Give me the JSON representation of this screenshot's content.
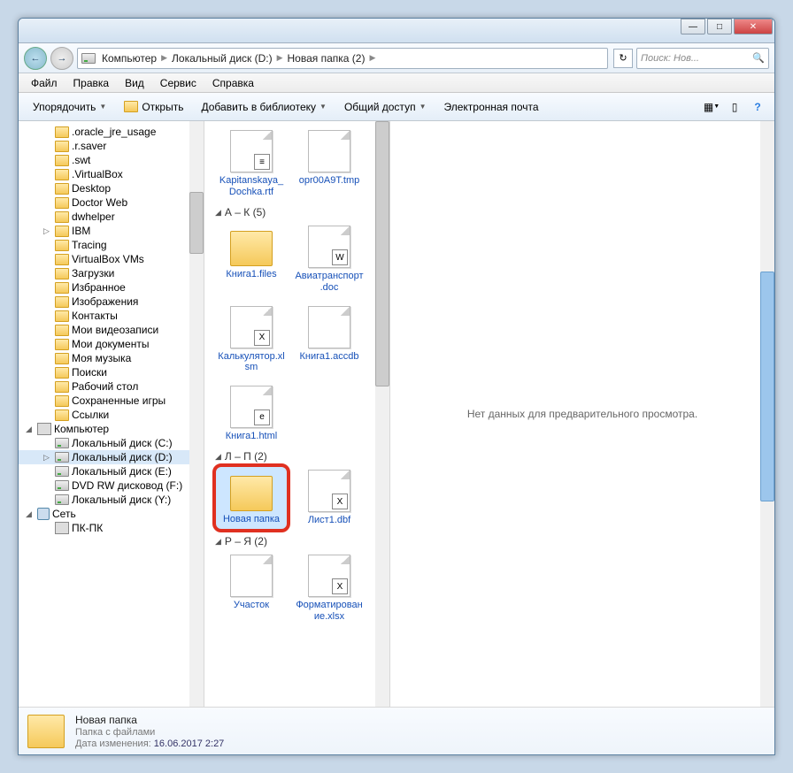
{
  "titlebar": {
    "min": "—",
    "max": "□",
    "close": "✕"
  },
  "nav": {
    "back": "←",
    "fwd": "→"
  },
  "breadcrumb": {
    "root": "Компьютер",
    "drive": "Локальный диск (D:)",
    "folder": "Новая папка (2)"
  },
  "refresh": "↻",
  "search": {
    "placeholder": "Поиск: Нов..."
  },
  "menu": {
    "file": "Файл",
    "edit": "Правка",
    "view": "Вид",
    "tools": "Сервис",
    "help": "Справка"
  },
  "toolbar": {
    "organize": "Упорядочить",
    "open": "Открыть",
    "library": "Добавить в библиотеку",
    "share": "Общий доступ",
    "email": "Электронная почта",
    "help": "?"
  },
  "tree": {
    "items": [
      {
        "l": 1,
        "icon": "folder",
        "label": ".oracle_jre_usage"
      },
      {
        "l": 1,
        "icon": "folder",
        "label": ".r.saver"
      },
      {
        "l": 1,
        "icon": "folder",
        "label": ".swt"
      },
      {
        "l": 1,
        "icon": "folder",
        "label": ".VirtualBox"
      },
      {
        "l": 1,
        "icon": "folder",
        "label": "Desktop"
      },
      {
        "l": 1,
        "icon": "folder",
        "label": "Doctor Web"
      },
      {
        "l": 1,
        "icon": "folder",
        "label": "dwhelper"
      },
      {
        "l": 1,
        "icon": "folder",
        "label": "IBM",
        "exp": "▷"
      },
      {
        "l": 1,
        "icon": "folder",
        "label": "Tracing"
      },
      {
        "l": 1,
        "icon": "folder",
        "label": "VirtualBox VMs"
      },
      {
        "l": 1,
        "icon": "folder",
        "label": "Загрузки"
      },
      {
        "l": 1,
        "icon": "folder",
        "label": "Избранное"
      },
      {
        "l": 1,
        "icon": "folder",
        "label": "Изображения"
      },
      {
        "l": 1,
        "icon": "folder",
        "label": "Контакты"
      },
      {
        "l": 1,
        "icon": "folder",
        "label": "Мои видеозаписи"
      },
      {
        "l": 1,
        "icon": "folder",
        "label": "Мои документы"
      },
      {
        "l": 1,
        "icon": "folder",
        "label": "Моя музыка"
      },
      {
        "l": 1,
        "icon": "folder",
        "label": "Поиски"
      },
      {
        "l": 1,
        "icon": "folder",
        "label": "Рабочий стол"
      },
      {
        "l": 1,
        "icon": "folder",
        "label": "Сохраненные игры"
      },
      {
        "l": 1,
        "icon": "folder",
        "label": "Ссылки"
      },
      {
        "l": 0,
        "icon": "comp",
        "label": "Компьютер",
        "exp": "◢"
      },
      {
        "l": 1,
        "icon": "drive",
        "label": "Локальный диск (C:)"
      },
      {
        "l": 1,
        "icon": "drive",
        "label": "Локальный диск (D:)",
        "sel": true,
        "exp": "▷"
      },
      {
        "l": 1,
        "icon": "drive",
        "label": "Локальный диск (E:)"
      },
      {
        "l": 1,
        "icon": "drive",
        "label": "DVD RW дисковод (F:)"
      },
      {
        "l": 1,
        "icon": "drive",
        "label": "Локальный диск (Y:)"
      },
      {
        "l": 0,
        "icon": "net",
        "label": "Сеть",
        "exp": "◢"
      },
      {
        "l": 1,
        "icon": "comp",
        "label": "ПК-ПК"
      }
    ]
  },
  "groups": [
    {
      "pre": true,
      "items": [
        {
          "label": "Kapitanskaya_Dochka.rtf",
          "icon": "doc",
          "badge": "≡"
        },
        {
          "label": "opr00A9T.tmp",
          "icon": "doc"
        }
      ]
    },
    {
      "title": "А – К (5)",
      "items": [
        {
          "label": "Книга1.files",
          "icon": "folder"
        },
        {
          "label": "Авиатранспорт.doc",
          "icon": "doc",
          "badge": "W"
        },
        {
          "label": "Калькулятор.xlsm",
          "icon": "doc",
          "badge": "X"
        },
        {
          "label": "Книга1.accdb",
          "icon": "doc"
        },
        {
          "label": "Книга1.html",
          "icon": "doc",
          "badge": "e"
        }
      ]
    },
    {
      "title": "Л – П (2)",
      "items": [
        {
          "label": "Новая папка",
          "icon": "folder",
          "sel": true,
          "hl": true
        },
        {
          "label": "Лист1.dbf",
          "icon": "doc",
          "badge": "X"
        }
      ]
    },
    {
      "title": "Р – Я (2)",
      "items": [
        {
          "label": "Участок",
          "icon": "doc"
        },
        {
          "label": "Форматирование.xlsx",
          "icon": "doc",
          "badge": "X"
        }
      ]
    }
  ],
  "preview": {
    "empty": "Нет данных для предварительного просмотра."
  },
  "details": {
    "title": "Новая папка",
    "type": "Папка с файлами",
    "mod_label": "Дата изменения:",
    "mod_value": "16.06.2017 2:27"
  }
}
